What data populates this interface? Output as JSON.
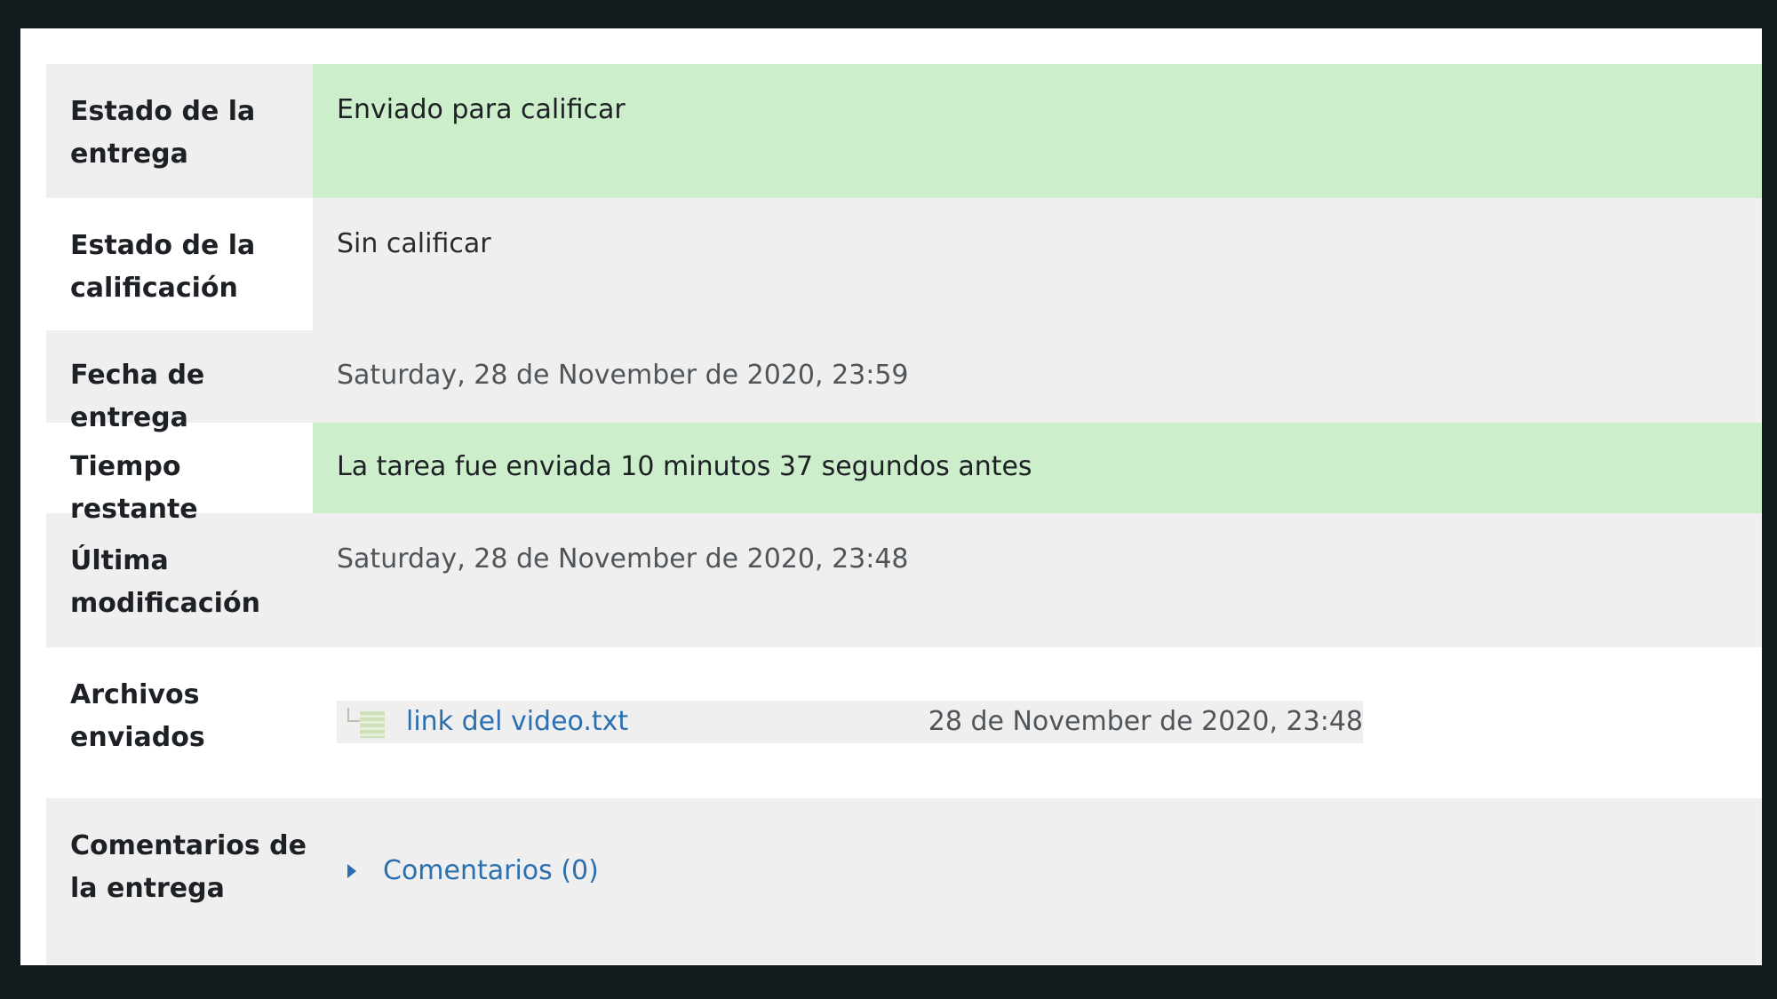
{
  "rows": [
    {
      "label": "Estado de la entrega",
      "value": "Enviado para calificar"
    },
    {
      "label": "Estado de la calificación",
      "value": "Sin calificar"
    },
    {
      "label": "Fecha de entrega",
      "value": "Saturday, 28 de November de 2020, 23:59"
    },
    {
      "label": "Tiempo restante",
      "value": "La tarea fue enviada 10 minutos 37 segundos antes"
    },
    {
      "label": "Última modificación",
      "value": "Saturday, 28 de November de 2020, 23:48"
    },
    {
      "label": "Archivos enviados"
    },
    {
      "label": "Comentarios de la entrega"
    }
  ],
  "file": {
    "name": "link del video.txt",
    "date": "28 de November de 2020, 23:48",
    "icon": "text-file-icon"
  },
  "comments": {
    "label": "Comentarios (0)",
    "icon": "caret-right-icon"
  },
  "colors": {
    "success_bg": "#cdeecb",
    "row_gray": "#efefef",
    "link": "#2a6fb0"
  }
}
